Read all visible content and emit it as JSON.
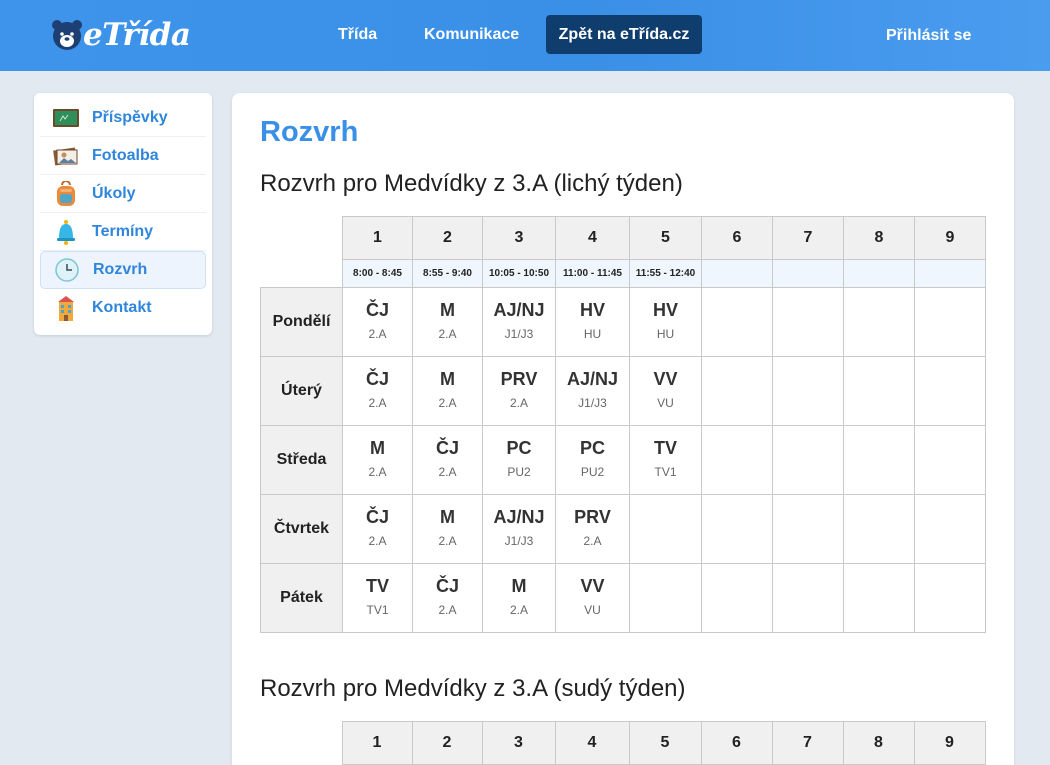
{
  "header": {
    "logo_text": "eTřída",
    "nav": [
      "Třída",
      "Komunikace"
    ],
    "back_button": "Zpět na eTřída.cz",
    "login": "Přihlásit se"
  },
  "sidebar": {
    "items": [
      {
        "label": "Příspěvky",
        "icon": "blackboard-icon",
        "active": false
      },
      {
        "label": "Fotoalba",
        "icon": "photo-album-icon",
        "active": false
      },
      {
        "label": "Úkoly",
        "icon": "backpack-icon",
        "active": false
      },
      {
        "label": "Termíny",
        "icon": "bell-icon",
        "active": false
      },
      {
        "label": "Rozvrh",
        "icon": "clock-icon",
        "active": true
      },
      {
        "label": "Kontakt",
        "icon": "school-building-icon",
        "active": false
      }
    ]
  },
  "main": {
    "title": "Rozvrh",
    "weeks": [
      {
        "title": "Rozvrh pro Medvídky z 3.A (lichý týden)",
        "periods": [
          "1",
          "2",
          "3",
          "4",
          "5",
          "6",
          "7",
          "8",
          "9"
        ],
        "times": [
          "8:00 - 8:45",
          "8:55 - 9:40",
          "10:05 - 10:50",
          "11:00 - 11:45",
          "11:55 - 12:40",
          "",
          "",
          "",
          ""
        ],
        "days": [
          {
            "name": "Pondělí",
            "lessons": [
              {
                "subject": "ČJ",
                "room": "2.A"
              },
              {
                "subject": "M",
                "room": "2.A"
              },
              {
                "subject": "AJ/NJ",
                "room": "J1/J3"
              },
              {
                "subject": "HV",
                "room": "HU"
              },
              {
                "subject": "HV",
                "room": "HU"
              },
              null,
              null,
              null,
              null
            ]
          },
          {
            "name": "Úterý",
            "lessons": [
              {
                "subject": "ČJ",
                "room": "2.A"
              },
              {
                "subject": "M",
                "room": "2.A"
              },
              {
                "subject": "PRV",
                "room": "2.A"
              },
              {
                "subject": "AJ/NJ",
                "room": "J1/J3"
              },
              {
                "subject": "VV",
                "room": "VU"
              },
              null,
              null,
              null,
              null
            ]
          },
          {
            "name": "Středa",
            "lessons": [
              {
                "subject": "M",
                "room": "2.A"
              },
              {
                "subject": "ČJ",
                "room": "2.A"
              },
              {
                "subject": "PC",
                "room": "PU2"
              },
              {
                "subject": "PC",
                "room": "PU2"
              },
              {
                "subject": "TV",
                "room": "TV1"
              },
              null,
              null,
              null,
              null
            ]
          },
          {
            "name": "Čtvrtek",
            "lessons": [
              {
                "subject": "ČJ",
                "room": "2.A"
              },
              {
                "subject": "M",
                "room": "2.A"
              },
              {
                "subject": "AJ/NJ",
                "room": "J1/J3"
              },
              {
                "subject": "PRV",
                "room": "2.A"
              },
              null,
              null,
              null,
              null,
              null
            ]
          },
          {
            "name": "Pátek",
            "lessons": [
              {
                "subject": "TV",
                "room": "TV1"
              },
              {
                "subject": "ČJ",
                "room": "2.A"
              },
              {
                "subject": "M",
                "room": "2.A"
              },
              {
                "subject": "VV",
                "room": "VU"
              },
              null,
              null,
              null,
              null,
              null
            ]
          }
        ]
      },
      {
        "title": "Rozvrh pro Medvídky z 3.A (sudý týden)",
        "periods": [
          "1",
          "2",
          "3",
          "4",
          "5",
          "6",
          "7",
          "8",
          "9"
        ]
      }
    ]
  },
  "colors": {
    "header_blue": "#3e94ea",
    "accent_blue": "#3990e6",
    "back_button_bg": "#0f3e6e",
    "page_bg": "#e3e9f1"
  }
}
